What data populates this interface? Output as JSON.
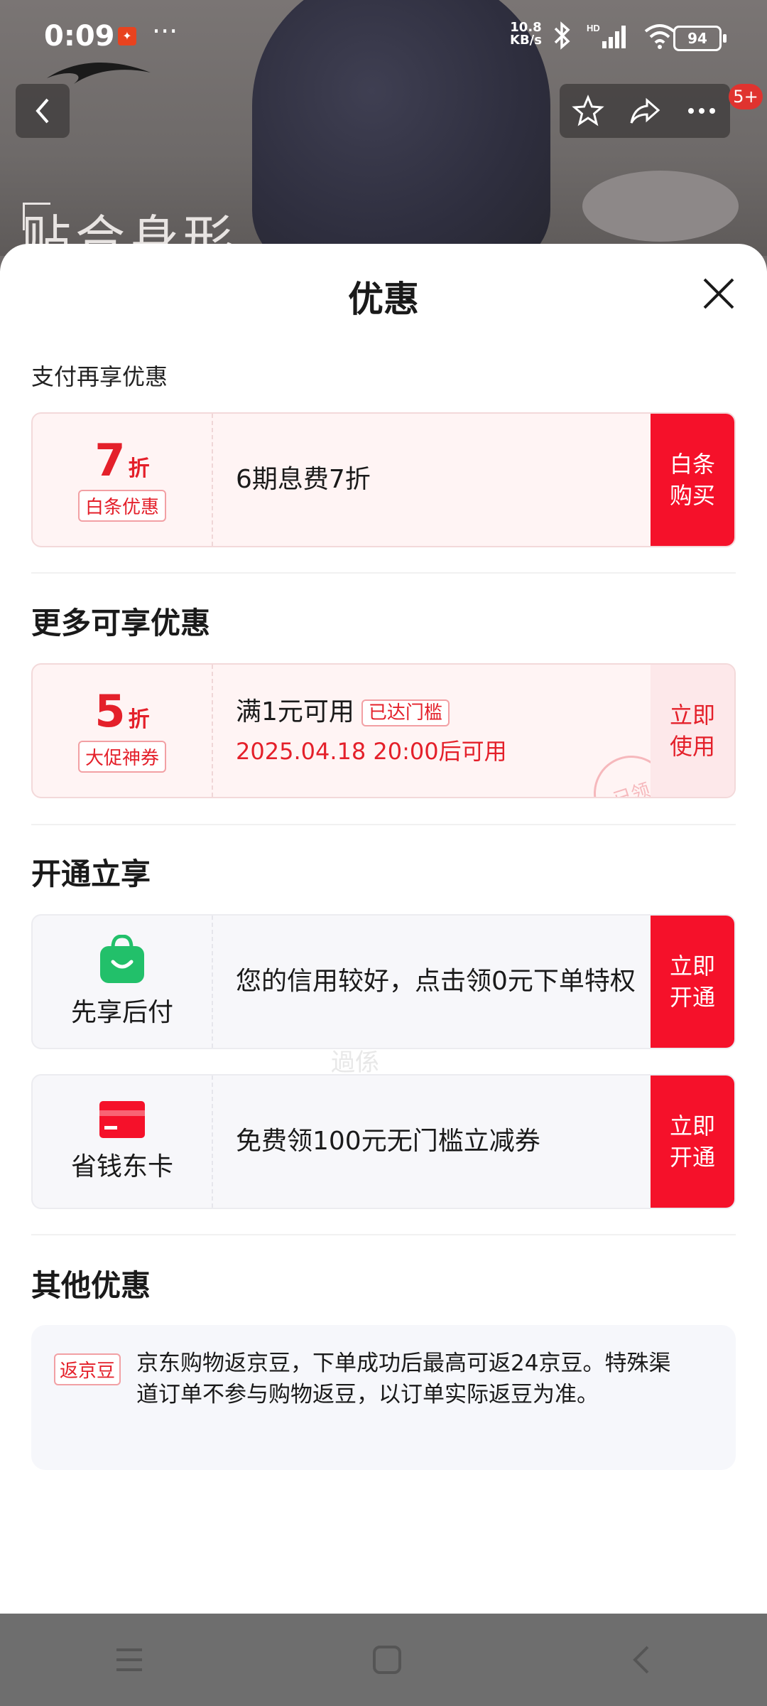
{
  "status_bar": {
    "time": "0:09",
    "dots": "···",
    "speed_value": "10.8",
    "speed_unit": "KB/s",
    "battery": "94"
  },
  "background": {
    "headline": "贴合身形",
    "badge": "5+"
  },
  "sheet": {
    "title": "优惠",
    "pay_section_label": "支付再享优惠",
    "baitiao": {
      "discount_num": "7",
      "discount_unit": "折",
      "tag": "白条优惠",
      "desc": "6期息费7折",
      "action": "白条购买"
    },
    "more_section_label": "更多可享优惠",
    "coupon": {
      "discount_num": "5",
      "discount_unit": "折",
      "tag": "大促神券",
      "desc": "满1元可用",
      "threshold_tag": "已达门槛",
      "time": "2025.04.18 20:00后可用",
      "action": "立即使用",
      "stamp": "已领"
    },
    "watermark": "過係",
    "open_section_label": "开通立享",
    "pay_later": {
      "label": "先享后付",
      "desc": "您的信用较好，点击领0元下单特权",
      "action": "立即开通"
    },
    "save_card": {
      "label": "省钱东卡",
      "desc": "免费领100元无门槛立减券",
      "action": "立即开通"
    },
    "other_section_label": "其他优惠",
    "other": {
      "tag": "返京豆",
      "text": "京东购物返京豆，下单成功后最高可返24京豆。特殊渠道订单不参与购物返豆，以订单实际返豆为准。"
    }
  },
  "colors": {
    "accent": "#f5112a",
    "accent_text": "#e4202a",
    "card_pink": "#fff4f4",
    "green": "#22c06a"
  }
}
